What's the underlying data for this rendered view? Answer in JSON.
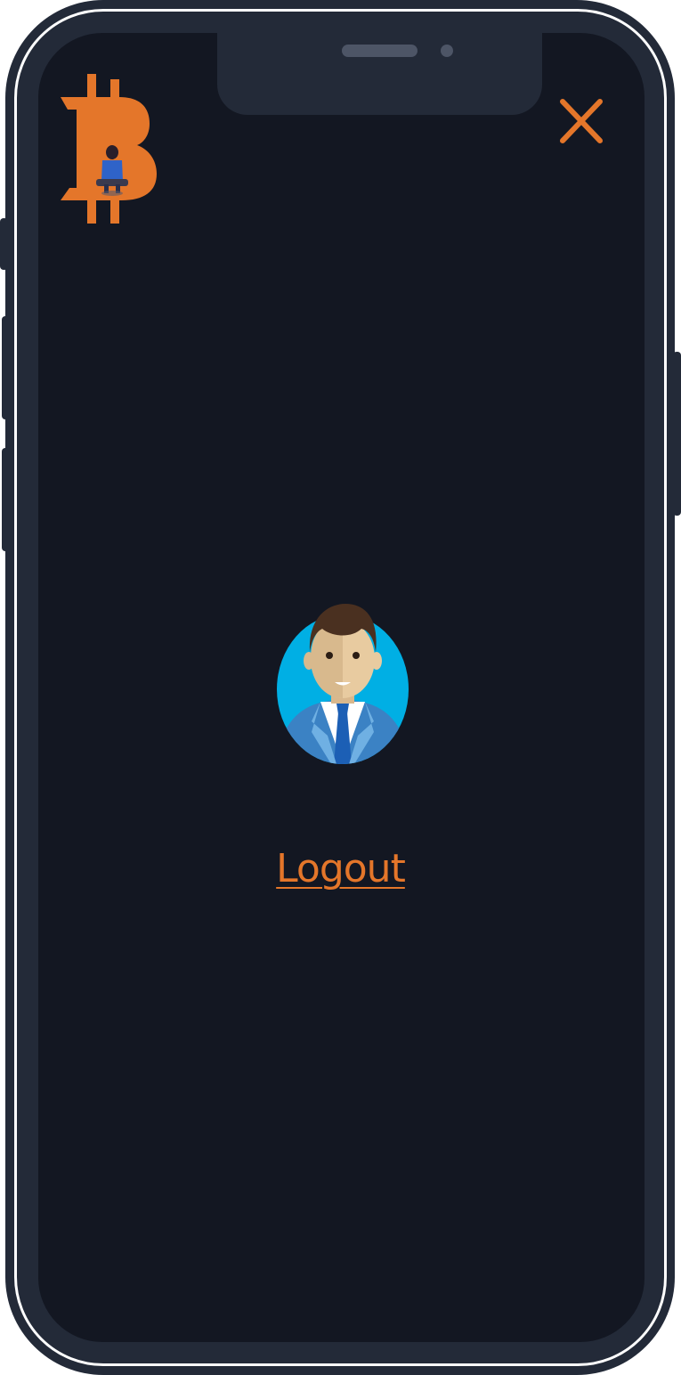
{
  "app": {
    "logo_icon": "bitcoin-logo-icon",
    "accent_color": "#e4762a",
    "background_color": "#131722",
    "frame_color": "#232a38"
  },
  "header": {
    "close_icon": "close-icon"
  },
  "profile": {
    "avatar_icon": "user-avatar-icon"
  },
  "menu": {
    "logout_label": "Logout"
  }
}
